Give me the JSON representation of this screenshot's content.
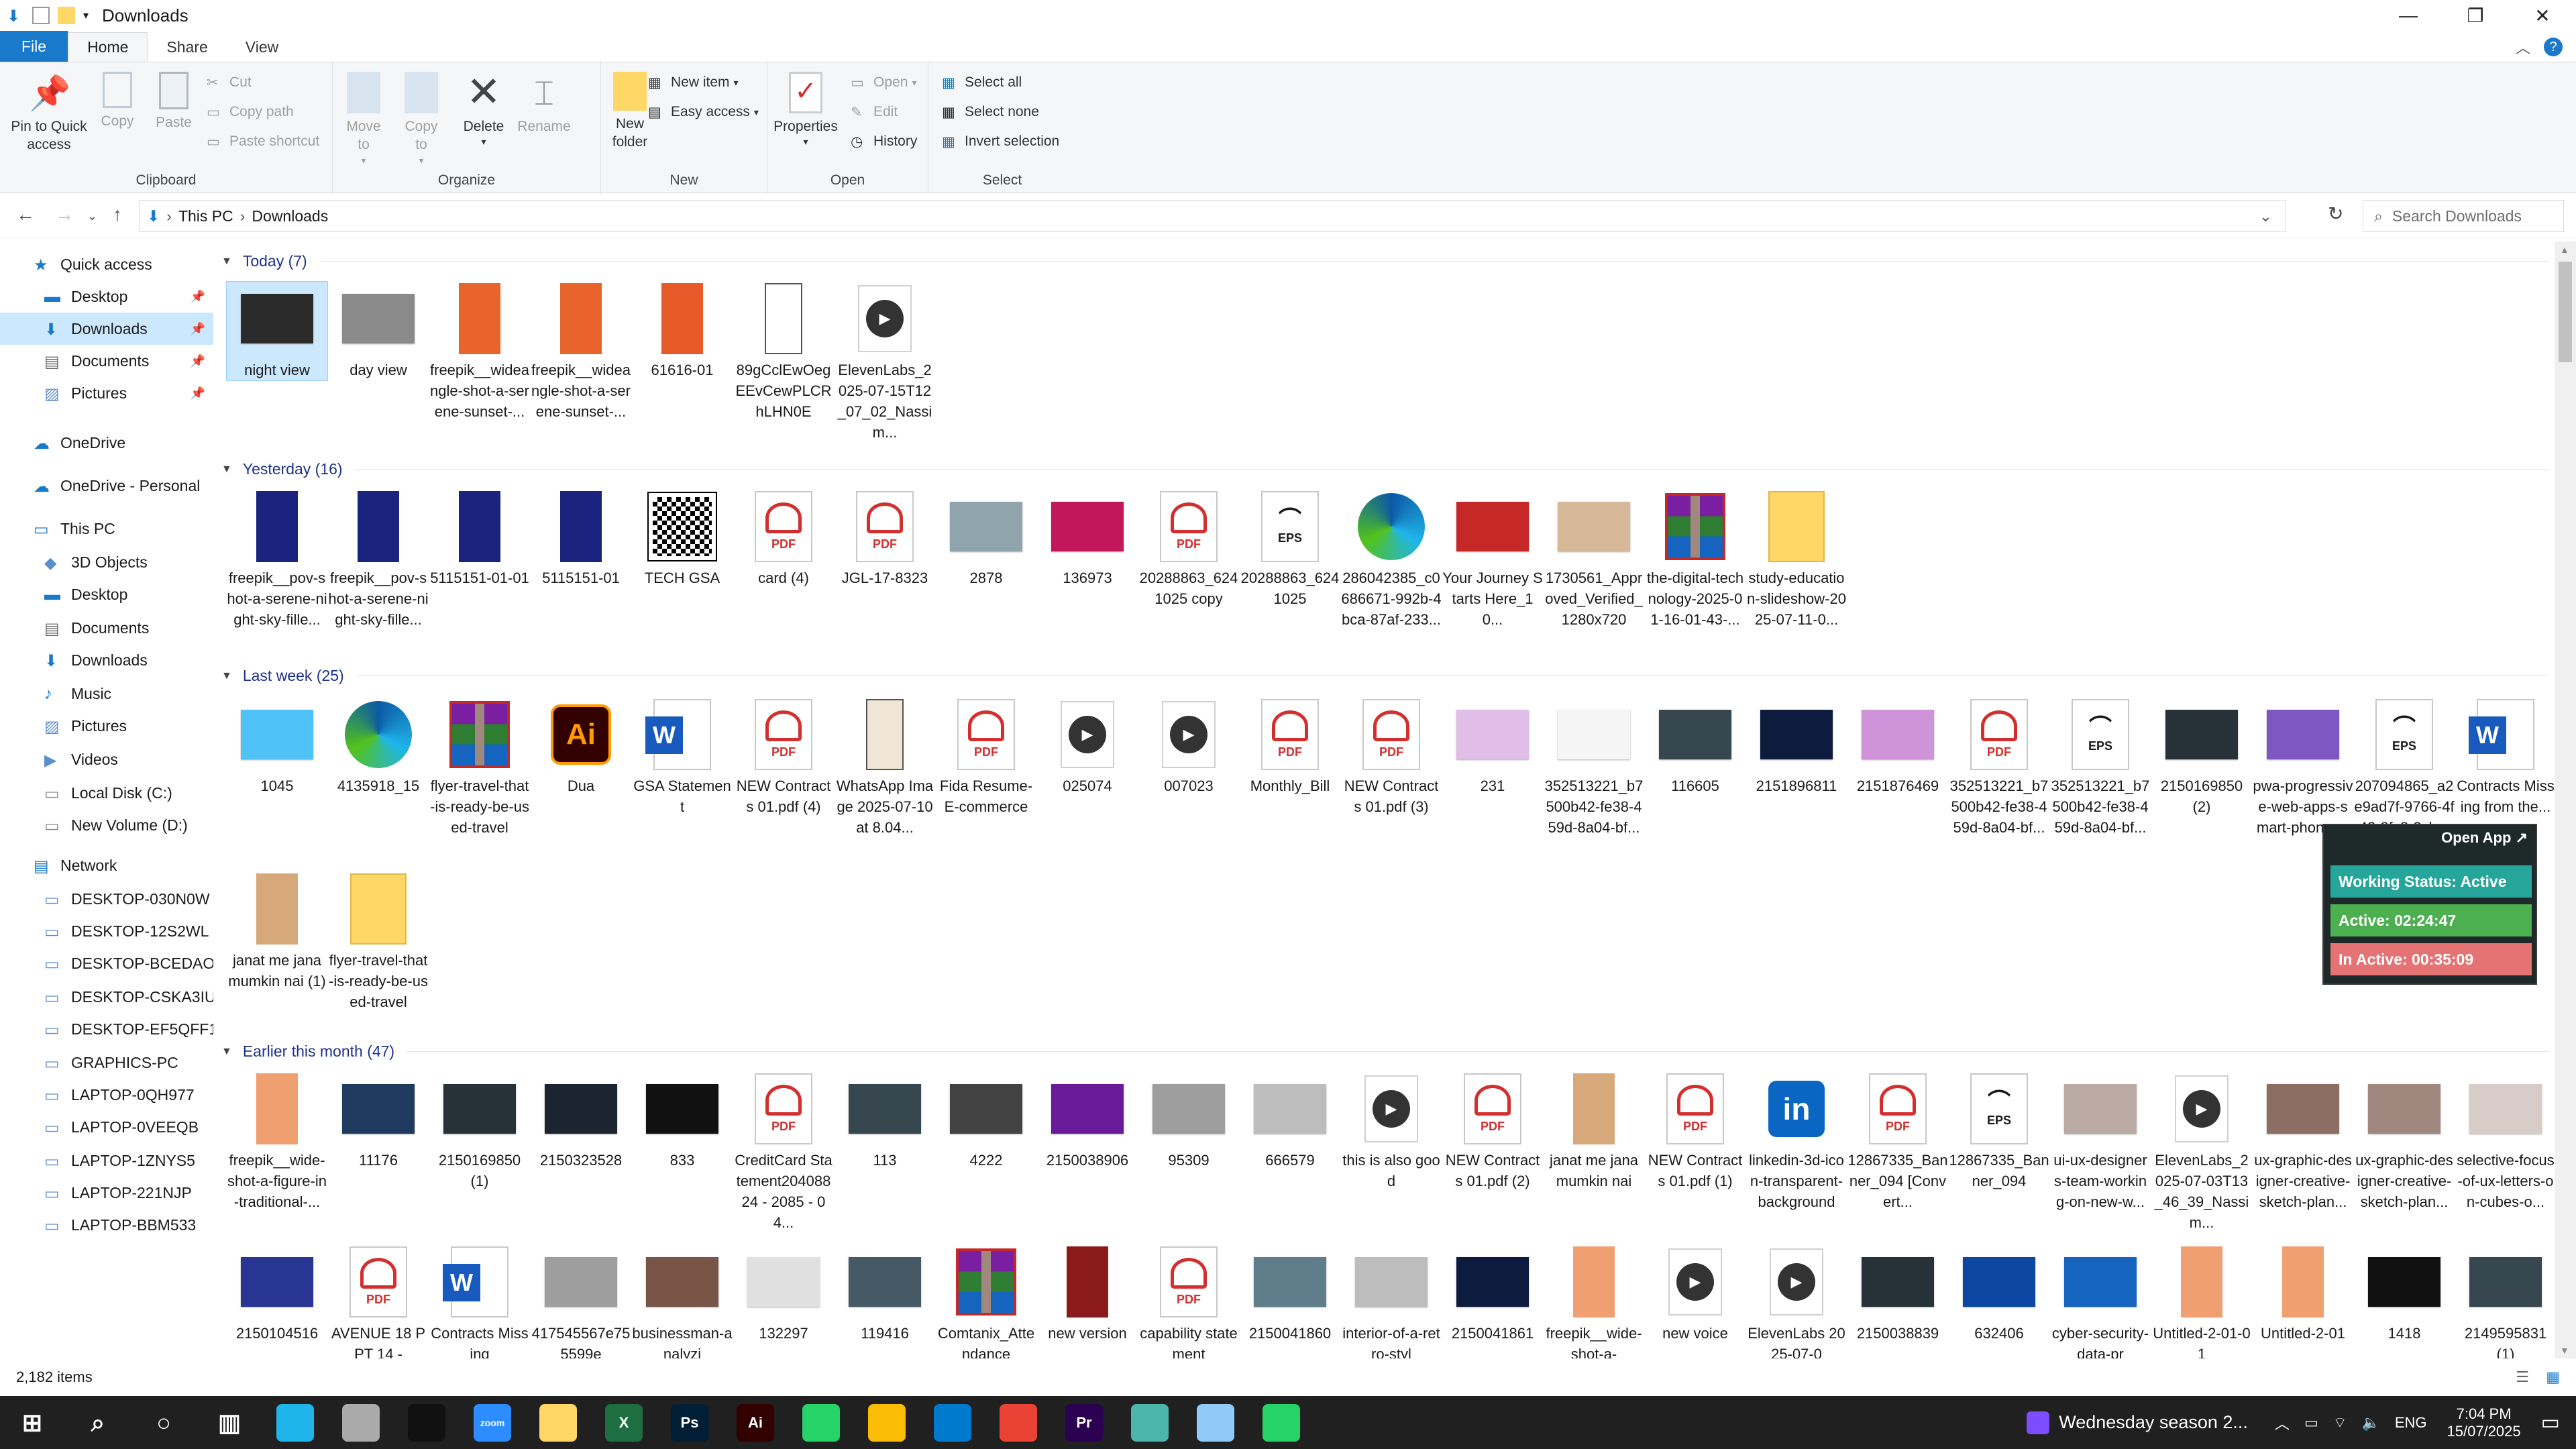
{
  "window": {
    "title": "Downloads"
  },
  "tabs": [
    "File",
    "Home",
    "Share",
    "View"
  ],
  "ribbon": {
    "clipboard": {
      "label": "Clipboard",
      "pin": "Pin to Quick access",
      "copy": "Copy",
      "paste": "Paste",
      "cut": "Cut",
      "copy_path": "Copy path",
      "paste_shortcut": "Paste shortcut"
    },
    "organize": {
      "label": "Organize",
      "move_to": "Move to",
      "copy_to": "Copy to",
      "delete": "Delete",
      "rename": "Rename"
    },
    "new": {
      "label": "New",
      "new_folder": "New folder",
      "new_item": "New item",
      "easy_access": "Easy access"
    },
    "open": {
      "label": "Open",
      "properties": "Properties",
      "open": "Open",
      "edit": "Edit",
      "history": "History"
    },
    "select": {
      "label": "Select",
      "select_all": "Select all",
      "select_none": "Select none",
      "invert": "Invert selection"
    }
  },
  "address": {
    "crumbs": [
      "This PC",
      "Downloads"
    ],
    "search_placeholder": "Search Downloads"
  },
  "nav": [
    {
      "label": "Quick access",
      "type": "star"
    },
    {
      "label": "Desktop",
      "type": "desk",
      "pin": true
    },
    {
      "label": "Downloads",
      "type": "down",
      "pin": true,
      "sel": true
    },
    {
      "label": "Documents",
      "type": "doc",
      "pin": true
    },
    {
      "label": "Pictures",
      "type": "pic",
      "pin": true
    },
    {
      "label": "OneDrive",
      "type": "cloud"
    },
    {
      "label": "OneDrive - Personal",
      "type": "cloud"
    },
    {
      "label": "This PC",
      "type": "pc"
    },
    {
      "label": "3D Objects",
      "type": "3d"
    },
    {
      "label": "Desktop",
      "type": "desk"
    },
    {
      "label": "Documents",
      "type": "doc"
    },
    {
      "label": "Downloads",
      "type": "down"
    },
    {
      "label": "Music",
      "type": "music"
    },
    {
      "label": "Pictures",
      "type": "pic"
    },
    {
      "label": "Videos",
      "type": "vid"
    },
    {
      "label": "Local Disk (C:)",
      "type": "disk"
    },
    {
      "label": "New Volume (D:)",
      "type": "disk"
    },
    {
      "label": "Network",
      "type": "net"
    },
    {
      "label": "DESKTOP-030N0W",
      "type": "host"
    },
    {
      "label": "DESKTOP-12S2WL",
      "type": "host"
    },
    {
      "label": "DESKTOP-BCEDAOC",
      "type": "host"
    },
    {
      "label": "DESKTOP-CSKA3IU",
      "type": "host"
    },
    {
      "label": "DESKTOP-EF5QFF1",
      "type": "host"
    },
    {
      "label": "GRAPHICS-PC",
      "type": "host"
    },
    {
      "label": "LAPTOP-0QH977",
      "type": "host"
    },
    {
      "label": "LAPTOP-0VEEQB",
      "type": "host"
    },
    {
      "label": "LAPTOP-1ZNYS5",
      "type": "host"
    },
    {
      "label": "LAPTOP-221NJP",
      "type": "host"
    },
    {
      "label": "LAPTOP-BBM533",
      "type": "host"
    }
  ],
  "groups": [
    {
      "title": "Today (7)",
      "rows": [
        [
          {
            "n": "night view",
            "t": "img",
            "c": "#2b2b2b",
            "sel": true
          },
          {
            "n": "day view",
            "t": "img",
            "c": "#8a8a8a"
          },
          {
            "n": "freepik__wideangle-shot-a-serene-sunset-...",
            "t": "tall",
            "c": "#e8642a"
          },
          {
            "n": "freepik__wideangle-shot-a-serene-sunset-...",
            "t": "tall",
            "c": "#e8642a"
          },
          {
            "n": "61616-01",
            "t": "tall",
            "c": "#e65a2a"
          },
          {
            "n": "89gCclEwOegEEvCewPLCRhLHN0E",
            "t": "phone",
            "c": "#fff"
          },
          {
            "n": "ElevenLabs_2025-07-15T12_07_02_Nassim...",
            "t": "vid"
          }
        ]
      ]
    },
    {
      "title": "Yesterday (16)",
      "rows": [
        [
          {
            "n": "freepik__pov-shot-a-serene-night-sky-fille...",
            "t": "tall",
            "c": "#1a237e"
          },
          {
            "n": "freepik__pov-shot-a-serene-night-sky-fille...",
            "t": "tall",
            "c": "#1a237e"
          },
          {
            "n": "5115151-01-01",
            "t": "tall",
            "c": "#1a237e"
          },
          {
            "n": "5115151-01",
            "t": "tall",
            "c": "#1a237e"
          },
          {
            "n": "TECH GSA",
            "t": "qr"
          },
          {
            "n": "card (4)",
            "t": "pdf"
          },
          {
            "n": "JGL-17-8323",
            "t": "pdf"
          },
          {
            "n": "2878",
            "t": "img",
            "c": "#90a4ae"
          },
          {
            "n": "136973",
            "t": "img",
            "c": "#c2185b"
          },
          {
            "n": "20288863_6241025 copy",
            "t": "pdf"
          },
          {
            "n": "20288863_6241025",
            "t": "eps"
          },
          {
            "n": "286042385_c0686671-992b-4bca-87af-233...",
            "t": "edge"
          },
          {
            "n": "Your Journey Starts Here_10...",
            "t": "img",
            "c": "#c62828"
          },
          {
            "n": "1730561_Approved_Verified_1280x720",
            "t": "img",
            "c": "#d7b99a"
          },
          {
            "n": "the-digital-technology-2025-01-16-01-43-...",
            "t": "rar"
          },
          {
            "n": "study-education-slideshow-2025-07-11-0...",
            "t": "folder"
          }
        ]
      ]
    },
    {
      "title": "Last week (25)",
      "rows": [
        [
          {
            "n": "1045",
            "t": "img",
            "c": "#4fc3f7"
          },
          {
            "n": "4135918_15",
            "t": "edge"
          },
          {
            "n": "flyer-travel-that-is-ready-be-used-travel",
            "t": "rar"
          },
          {
            "n": "Dua",
            "t": "ai"
          },
          {
            "n": "GSA Statement",
            "t": "word"
          },
          {
            "n": "NEW Contracts 01.pdf (4)",
            "t": "pdf"
          },
          {
            "n": "WhatsApp Image 2025-07-10 at 8.04...",
            "t": "phone",
            "c": "#efe6d5"
          },
          {
            "n": "Fida Resume-E-commerce",
            "t": "pdf"
          },
          {
            "n": "025074",
            "t": "vid"
          },
          {
            "n": "007023",
            "t": "vid"
          },
          {
            "n": "Monthly_Bill",
            "t": "pdf"
          },
          {
            "n": "NEW Contracts 01.pdf (3)",
            "t": "pdf"
          },
          {
            "n": "231",
            "t": "img",
            "c": "#e1bee7"
          },
          {
            "n": "352513221_b7500b42-fe38-459d-8a04-bf...",
            "t": "img",
            "c": "#f5f5f5"
          },
          {
            "n": "116605",
            "t": "img",
            "c": "#37474f"
          },
          {
            "n": "2151896811",
            "t": "img",
            "c": "#0d1b3e"
          },
          {
            "n": "2151876469",
            "t": "img",
            "c": "#ce93d8"
          },
          {
            "n": "352513221_b7500b42-fe38-459d-8a04-bf...",
            "t": "pdf"
          },
          {
            "n": "352513221_b7500b42-fe38-459d-8a04-bf...",
            "t": "eps"
          },
          {
            "n": "2150169850 (2)",
            "t": "img",
            "c": "#263238"
          },
          {
            "n": "pwa-progressive-web-apps-smart-phone-...",
            "t": "img",
            "c": "#7e57c2"
          },
          {
            "n": "207094865_a2e9ad7f-9766-4f43-8fc8-3cb...",
            "t": "eps"
          },
          {
            "n": "Contracts Missing from the...",
            "t": "word"
          }
        ],
        [
          {
            "n": "janat me jana mumkin nai (1)",
            "t": "tall",
            "c": "#d7a97a"
          },
          {
            "n": "flyer-travel-that-is-ready-be-used-travel",
            "t": "folder"
          }
        ]
      ]
    },
    {
      "title": "Earlier this month (47)",
      "rows": [
        [
          {
            "n": "freepik__wide-shot-a-figure-in-traditional-...",
            "t": "tall",
            "c": "#f0a070"
          },
          {
            "n": "11176",
            "t": "img",
            "c": "#1e3a5f"
          },
          {
            "n": "2150169850 (1)",
            "t": "img",
            "c": "#263238"
          },
          {
            "n": "2150323528",
            "t": "img",
            "c": "#1c2331"
          },
          {
            "n": "833",
            "t": "img",
            "c": "#111"
          },
          {
            "n": "CreditCard Statement20408824 - 2085 - 04...",
            "t": "pdf"
          },
          {
            "n": "113",
            "t": "img",
            "c": "#37474f"
          },
          {
            "n": "4222",
            "t": "img",
            "c": "#424242"
          },
          {
            "n": "2150038906",
            "t": "img",
            "c": "#6a1b9a"
          },
          {
            "n": "95309",
            "t": "img",
            "c": "#9e9e9e"
          },
          {
            "n": "666579",
            "t": "img",
            "c": "#bdbdbd"
          },
          {
            "n": "this is also good",
            "t": "vid"
          },
          {
            "n": "NEW Contracts 01.pdf (2)",
            "t": "pdf"
          },
          {
            "n": "janat me jana mumkin nai",
            "t": "tall",
            "c": "#d7a97a"
          },
          {
            "n": "NEW Contracts 01.pdf (1)",
            "t": "pdf"
          },
          {
            "n": "linkedin-3d-icon-transparent-background",
            "t": "li"
          },
          {
            "n": "12867335_Banner_094 [Convert...",
            "t": "pdf"
          },
          {
            "n": "12867335_Banner_094",
            "t": "eps"
          },
          {
            "n": "ui-ux-designers-team-working-on-new-w...",
            "t": "img",
            "c": "#bcaaa4"
          },
          {
            "n": "ElevenLabs_2025-07-03T13_46_39_Nassim...",
            "t": "vid"
          },
          {
            "n": "ux-graphic-designer-creative-sketch-plan...",
            "t": "img",
            "c": "#8d6e63"
          },
          {
            "n": "ux-graphic-designer-creative-sketch-plan...",
            "t": "img",
            "c": "#a1887f"
          },
          {
            "n": "selective-focus-of-ux-letters-on-cubes-o...",
            "t": "img",
            "c": "#d7ccc8"
          }
        ],
        [
          {
            "n": "2150104516",
            "t": "img",
            "c": "#283593"
          },
          {
            "n": "AVENUE 18 PPT 14 -",
            "t": "pdf"
          },
          {
            "n": "Contracts Missing",
            "t": "word"
          },
          {
            "n": "417545567e755599e",
            "t": "img",
            "c": "#9e9e9e"
          },
          {
            "n": "businessman-analyzi",
            "t": "img",
            "c": "#795548"
          },
          {
            "n": "132297",
            "t": "img",
            "c": "#e0e0e0"
          },
          {
            "n": "119416",
            "t": "img",
            "c": "#455a64"
          },
          {
            "n": "Comtanix_Attendance",
            "t": "rar"
          },
          {
            "n": "new version",
            "t": "tall",
            "c": "#8b1a1a"
          },
          {
            "n": "capability statement",
            "t": "pdf"
          },
          {
            "n": "2150041860",
            "t": "img",
            "c": "#607d8b"
          },
          {
            "n": "interior-of-a-retro-styl",
            "t": "img",
            "c": "#bdbdbd"
          },
          {
            "n": "2150041861",
            "t": "img",
            "c": "#0d1b3e"
          },
          {
            "n": "freepik__wide-shot-a-",
            "t": "tall",
            "c": "#f0a070"
          },
          {
            "n": "new voice",
            "t": "vid"
          },
          {
            "n": "ElevenLabs 2025-07-0",
            "t": "vid"
          },
          {
            "n": "2150038839",
            "t": "img",
            "c": "#263238"
          },
          {
            "n": "632406",
            "t": "img",
            "c": "#0d47a1"
          },
          {
            "n": "cyber-security-data-pr",
            "t": "img",
            "c": "#1565c0"
          },
          {
            "n": "Untitled-2-01-01",
            "t": "tall",
            "c": "#f0a070"
          },
          {
            "n": "Untitled-2-01",
            "t": "tall",
            "c": "#f0a070"
          },
          {
            "n": "1418",
            "t": "img",
            "c": "#111"
          },
          {
            "n": "2149595831 (1)",
            "t": "img",
            "c": "#37474f"
          }
        ]
      ]
    }
  ],
  "status": {
    "count": "2,182 items"
  },
  "widget": {
    "open": "Open App",
    "status": "Working Status: Active",
    "active": "Active: 02:24:47",
    "inactive": "In Active: 00:35:09"
  },
  "taskbar": {
    "apps": [
      "start",
      "search",
      "cortana",
      "taskview",
      "edge",
      "pen",
      "terminal",
      "zoom",
      "explorer",
      "excel",
      "photoshop",
      "illustrator",
      "green1",
      "chrome",
      "vscode",
      "chrome2",
      "premiere",
      "app1",
      "app2",
      "green2"
    ],
    "media": "Wednesday season 2...",
    "lang": "ENG",
    "time": "7:04 PM",
    "date": "15/07/2025"
  },
  "colors": {
    "accent": "#1979ca",
    "selected": "#cce8ff",
    "link": "#1e3287"
  }
}
